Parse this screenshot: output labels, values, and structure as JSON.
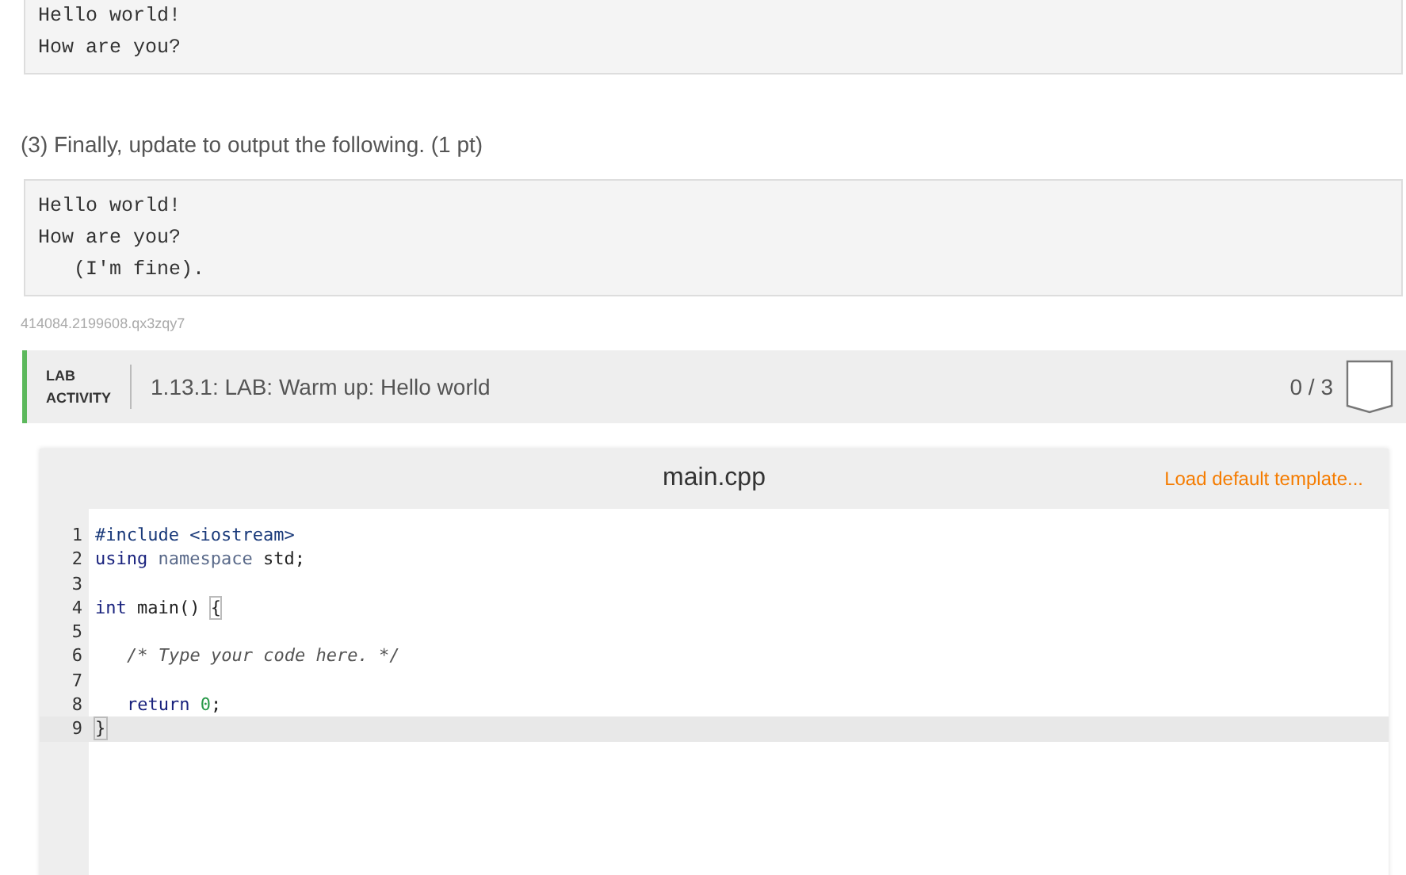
{
  "output_top": [
    "Hello world!",
    "How are you?"
  ],
  "prompt": "(3) Finally, update to output the following. (1 pt)",
  "output_final": [
    "Hello world!",
    "How are you?",
    "   (I'm fine)."
  ],
  "activity_id": "414084.2199608.qx3zqy7",
  "lab": {
    "label_top": "LAB",
    "label_bottom": "ACTIVITY",
    "title": "1.13.1: LAB: Warm up: Hello world",
    "score": "0 / 3"
  },
  "editor": {
    "filename": "main.cpp",
    "load_link": "Load default template...",
    "lines": [
      {
        "number": "1",
        "active": false,
        "tokens": [
          {
            "kind": "meta",
            "text": "#include <iostream>"
          }
        ]
      },
      {
        "number": "2",
        "active": false,
        "tokens": [
          {
            "kind": "keyword",
            "text": "using"
          },
          {
            "kind": "def",
            "text": " namespace"
          },
          {
            "kind": "plain",
            "text": " std;"
          }
        ]
      },
      {
        "number": "3",
        "active": false
      },
      {
        "number": "4",
        "active": false,
        "tokens": [
          {
            "kind": "keyword",
            "text": "int"
          },
          {
            "kind": "plain",
            "text": " main() "
          },
          {
            "kind": "bracket",
            "text": "{"
          }
        ]
      },
      {
        "number": "5",
        "active": false
      },
      {
        "number": "6",
        "active": false,
        "indent": true,
        "tokens": [
          {
            "kind": "comment",
            "text": "/* Type your code here. */"
          }
        ]
      },
      {
        "number": "7",
        "active": false
      },
      {
        "number": "8",
        "active": false,
        "indent": true,
        "tokens": [
          {
            "kind": "keyword",
            "text": "return"
          },
          {
            "kind": "number",
            "text": " 0"
          },
          {
            "kind": "plain",
            "text": ";"
          }
        ]
      },
      {
        "number": "9",
        "active": true,
        "tokens": [
          {
            "kind": "bracket",
            "text": "}"
          }
        ]
      }
    ]
  }
}
